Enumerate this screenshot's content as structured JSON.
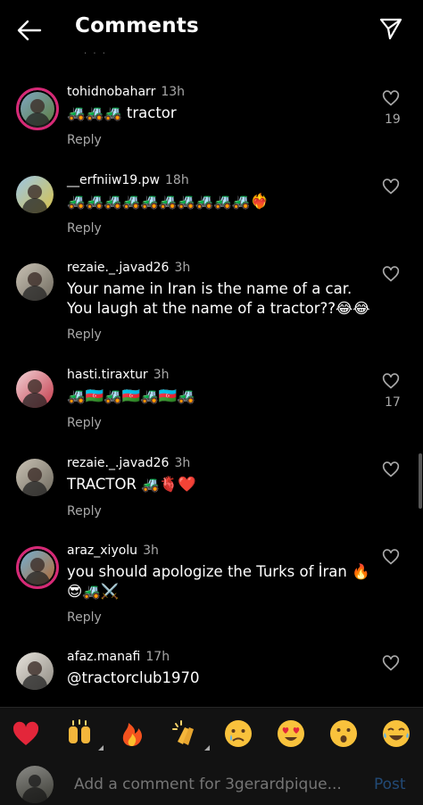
{
  "header": {
    "title": "Comments"
  },
  "previous_hint": "·  ·  ·",
  "comments": [
    {
      "username": "tohidnobaharr",
      "time": "13h",
      "text": "🚜🚜🚜 tractor",
      "reply": "Reply",
      "likes": "19",
      "story": true
    },
    {
      "username": "__erfniiw19.pw",
      "time": "18h",
      "text": "🚜🚜🚜🚜🚜🚜🚜🚜🚜🚜❤️‍🔥",
      "reply": "Reply",
      "likes": "",
      "story": false
    },
    {
      "username": "rezaie._.javad26",
      "time": "3h",
      "text": "Your name in Iran is the name of a car. You laugh at the name of a tractor??😂😂",
      "reply": "Reply",
      "likes": "",
      "story": false
    },
    {
      "username": "hasti.tiraxtur",
      "time": "3h",
      "text": "🚜🇦🇿🚜🇦🇿🚜🇦🇿🚜",
      "reply": "Reply",
      "likes": "17",
      "story": false
    },
    {
      "username": "rezaie._.javad26",
      "time": "3h",
      "text": "TRACTOR 🚜🫀❤️",
      "reply": "Reply",
      "likes": "",
      "story": false
    },
    {
      "username": "araz_xiyolu",
      "time": "3h",
      "text": "you should apologize the Turks of İran 🔥 😎🚜⚔️",
      "reply": "Reply",
      "likes": "",
      "story": true
    },
    {
      "username": "afaz.manafi",
      "time": "17h",
      "text": "@tractorclub1970",
      "reply": "",
      "likes": "",
      "story": false
    }
  ],
  "reactions": [
    "❤️",
    "🙌",
    "🔥",
    "👏",
    "😢",
    "😍",
    "😮",
    "😂"
  ],
  "composer": {
    "placeholder": "Add a comment for 3gerardpique...",
    "post_label": "Post"
  },
  "colors": {
    "background": "#000000",
    "secondary_text": "#a8a8a8",
    "post_disabled": "#224a76",
    "story_ring": "#d62976"
  }
}
